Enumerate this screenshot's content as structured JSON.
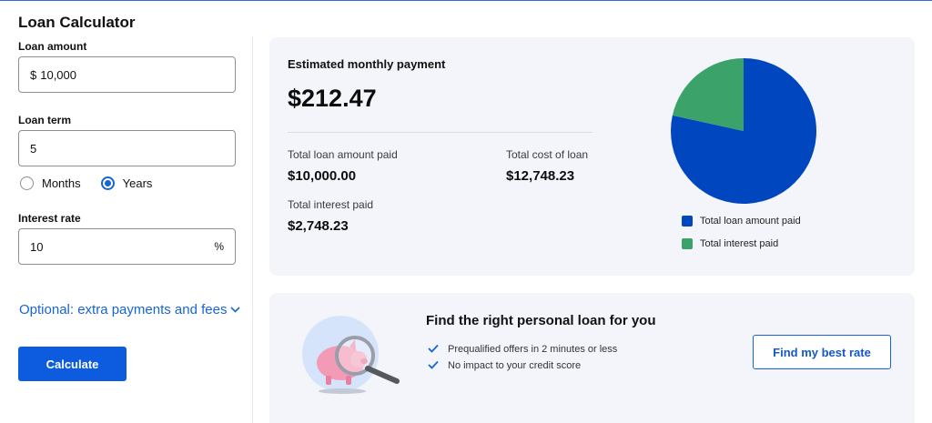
{
  "app": {
    "title": "Loan Calculator"
  },
  "form": {
    "loan_amount": {
      "label": "Loan amount",
      "prefix": "$",
      "value": "10,000"
    },
    "loan_term": {
      "label": "Loan term",
      "value": "5"
    },
    "term_unit": {
      "options": [
        {
          "label": "Months",
          "selected": false
        },
        {
          "label": "Years",
          "selected": true
        }
      ]
    },
    "interest_rate": {
      "label": "Interest rate",
      "value": "10",
      "suffix": "%"
    },
    "optional_link": "Optional: extra payments and fees",
    "calculate_label": "Calculate"
  },
  "results": {
    "estimate_label": "Estimated monthly payment",
    "estimate_value": "$212.47",
    "total_loan_label": "Total loan amount paid",
    "total_loan_value": "$10,000.00",
    "total_cost_label": "Total cost of loan",
    "total_cost_value": "$12,748.23",
    "total_interest_label": "Total interest paid",
    "total_interest_value": "$2,748.23"
  },
  "chart_data": {
    "type": "pie",
    "slices": [
      {
        "name": "Total loan amount paid",
        "value": 10000.0,
        "color": "#0047bf"
      },
      {
        "name": "Total interest paid",
        "value": 2748.23,
        "color": "#3ba36a"
      }
    ]
  },
  "promo": {
    "title": "Find the right personal loan for you",
    "bullets": [
      "Prequalified offers in 2 minutes or less",
      "No impact to your credit score"
    ],
    "button_label": "Find my best rate"
  },
  "icons": {
    "check": "check-icon",
    "chevron": "chevron-down-icon",
    "illustration": "piggy-bank-magnifier-icon"
  }
}
